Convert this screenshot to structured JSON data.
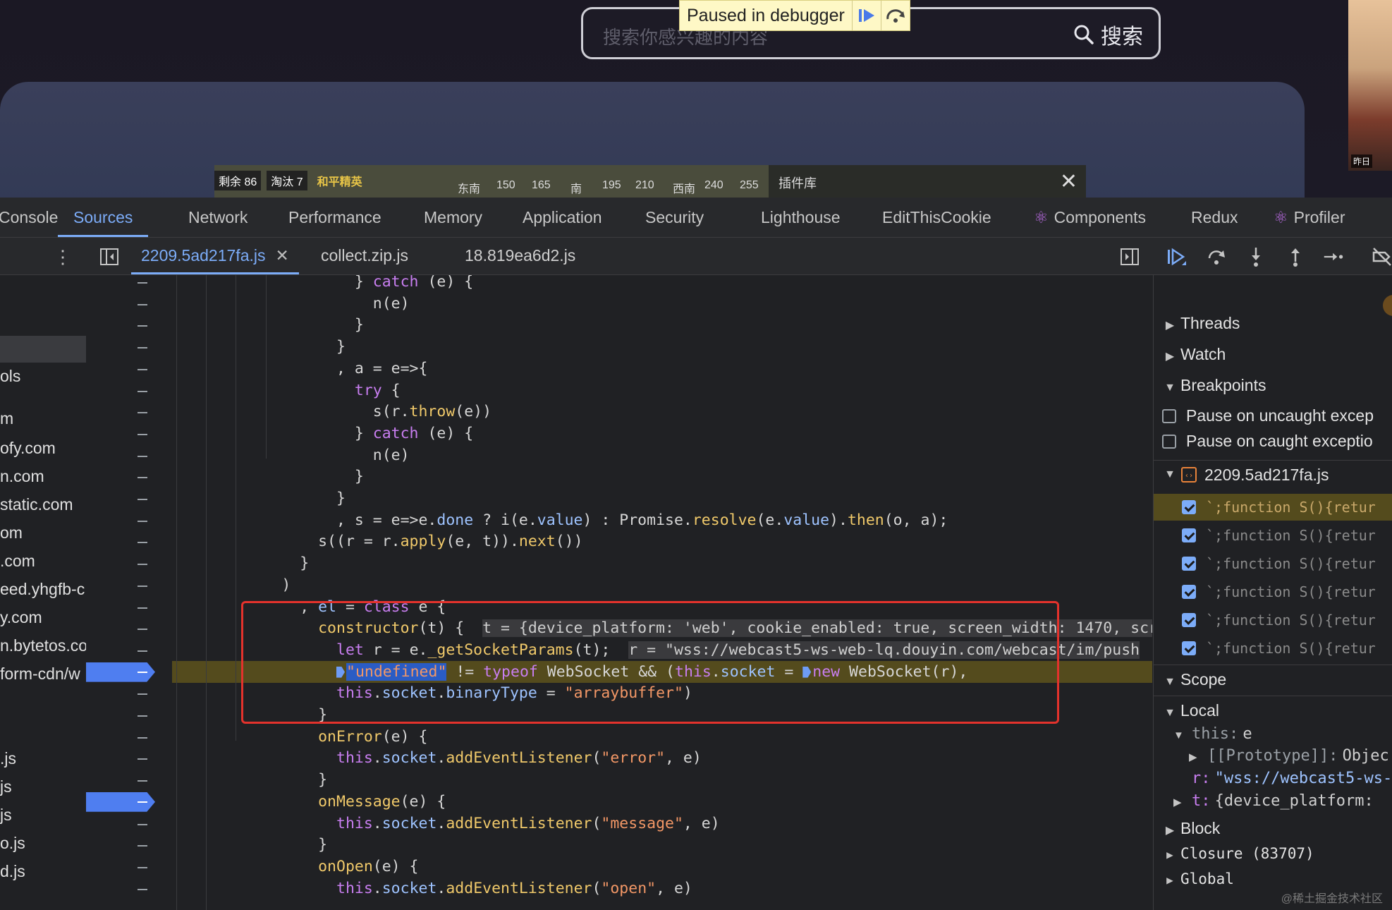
{
  "webpage": {
    "search_placeholder": "搜索你感兴趣的内容",
    "search_button": "搜索",
    "paused_banner": "Paused in debugger",
    "hud": {
      "remaining_label": "剩余",
      "remaining_value": "86",
      "eliminated_label": "淘汰",
      "eliminated_value": "7",
      "mode": "和平精英"
    },
    "compass_labels": [
      "东南",
      "150",
      "165",
      "南",
      "195",
      "210",
      "西南",
      "240",
      "255"
    ],
    "plugin_lib": "插件库",
    "thumb_caption": "昨日"
  },
  "devtools_tabs": [
    {
      "label": "Console"
    },
    {
      "label": "Sources"
    },
    {
      "label": "Network"
    },
    {
      "label": "Performance"
    },
    {
      "label": "Memory"
    },
    {
      "label": "Application"
    },
    {
      "label": "Security"
    },
    {
      "label": "Lighthouse"
    },
    {
      "label": "EditThisCookie"
    },
    {
      "label": "Components"
    },
    {
      "label": "Redux"
    },
    {
      "label": "Profiler"
    }
  ],
  "active_tab": "Sources",
  "file_tabs": [
    {
      "label": "2209.5ad217fa.js",
      "active": true
    },
    {
      "label": "collect.zip.js",
      "active": false
    },
    {
      "label": "18.819ea6d2.js",
      "active": false
    }
  ],
  "navigator": [
    "ols",
    "m",
    "ofy.com",
    "n.com",
    "static.com",
    "om",
    ".com",
    "eed.yhgfb-c",
    "y.com",
    "n.bytetos.co",
    "form-cdn/w",
    ".js",
    "js",
    "js",
    "o.js",
    "d.js"
  ],
  "code_lines": [
    "} catch (e) {",
    "n(e)",
    "}",
    "}",
    ", a = e=>{",
    "try {",
    "s(r.throw(e))",
    "} catch (e) {",
    "n(e)",
    "}",
    "}",
    ", s = e=>e.done ? i(e.value) : Promise.resolve(e.value).then(o, a);",
    "s((r = r.apply(e, t)).next())",
    "}",
    ")",
    ", el = class e {",
    "constructor(t) {",
    "let r = e._getSocketParams(t);",
    "\"undefined\" != typeof WebSocket && (this.socket = new WebSocket(r),",
    "this.socket.binaryType = \"arraybuffer\")",
    "}",
    "onError(e) {",
    "this.socket.addEventListener(\"error\", e)",
    "}",
    "onMessage(e) {",
    "this.socket.addEventListener(\"message\", e)",
    "}",
    "onOpen(e) {",
    "this.socket.addEventListener(\"open\", e)"
  ],
  "inline_values": {
    "constructor": "t = {device_platform: 'web', cookie_enabled: true, screen_width: 1470, scr",
    "let_r": "r = \"wss://webcast5-ws-web-lq.douyin.com/webcast/im/push"
  },
  "sidebar": {
    "threads": "Threads",
    "watch": "Watch",
    "breakpoints": "Breakpoints",
    "pause_uncaught": "Pause on uncaught excep",
    "pause_caught": "Pause on caught exceptio",
    "bp_file": "2209.5ad217fa.js",
    "bp_entries": [
      "`;function S(){retur",
      "`;function S(){retur",
      "`;function S(){retur",
      "`;function S(){retur",
      "`;function S(){retur",
      "`;function S(){retur"
    ],
    "scope": "Scope",
    "local": "Local",
    "this_key": "this:",
    "this_val": "e",
    "prototype_key": "[[Prototype]]:",
    "prototype_val": "Objec",
    "r_key": "r:",
    "r_val": "\"wss://webcast5-ws-",
    "t_key": "t:",
    "t_val": "{device_platform:",
    "block": "Block",
    "closure": "Closure (83707)",
    "global": "Global"
  },
  "watermark": "@稀土掘金技术社区",
  "colors": {
    "accent": "#7cacf8",
    "breakpoint": "#4f7ef0",
    "exec_line": "#544b1d",
    "highlight_box": "#e3322c"
  }
}
